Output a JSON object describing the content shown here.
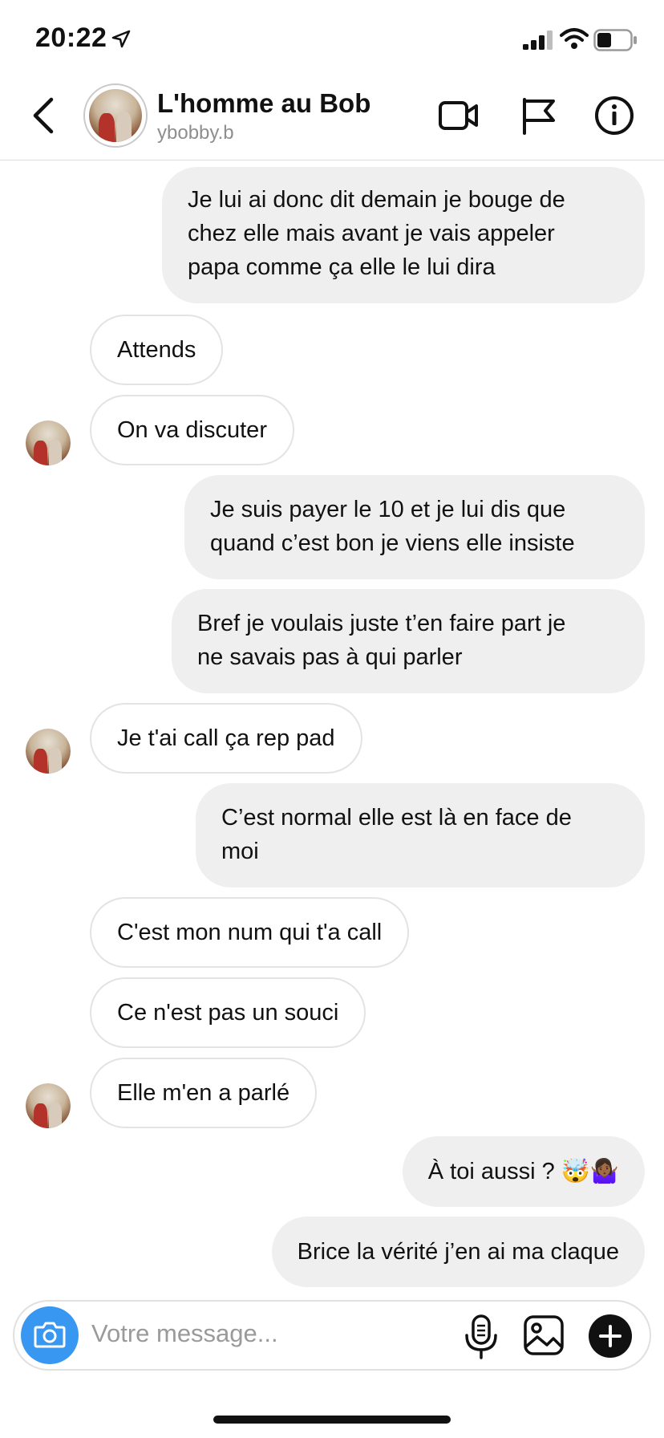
{
  "status_bar": {
    "time": "20:22"
  },
  "header": {
    "title": "L'homme au Bob",
    "username": "ybobby.b"
  },
  "messages": [
    {
      "side": "out",
      "lines": [
        "Je lui ai donc dit demain je bouge de",
        "chez elle mais avant je vais appeler",
        "papa comme ça elle le lui dira"
      ]
    },
    {
      "side": "in",
      "lines": [
        "Attends"
      ]
    },
    {
      "side": "in",
      "lines": [
        "On va discuter"
      ],
      "avatar": true
    },
    {
      "side": "out",
      "lines": [
        "Je suis payer le 10 et je lui dis que",
        "quand c’est bon je viens elle insiste"
      ]
    },
    {
      "side": "out",
      "lines": [
        "Bref je voulais juste t’en faire part je",
        "ne savais pas à qui parler"
      ]
    },
    {
      "side": "in",
      "lines": [
        "Je t'ai call ça rep pad"
      ],
      "avatar": true
    },
    {
      "side": "out",
      "lines": [
        "C’est normal elle est là en face de",
        "moi"
      ]
    },
    {
      "side": "in",
      "lines": [
        "C'est mon num qui t'a call"
      ]
    },
    {
      "side": "in",
      "lines": [
        "Ce n'est pas un souci"
      ]
    },
    {
      "side": "in",
      "lines": [
        "Elle m'en a parlé"
      ],
      "avatar": true
    },
    {
      "side": "out",
      "lines": [
        "À toi aussi ? 🤯🤷🏾‍♀️"
      ]
    },
    {
      "side": "out",
      "lines": [
        "Brice la vérité j’en ai ma claque"
      ]
    }
  ],
  "composer": {
    "placeholder": "Votre message..."
  }
}
